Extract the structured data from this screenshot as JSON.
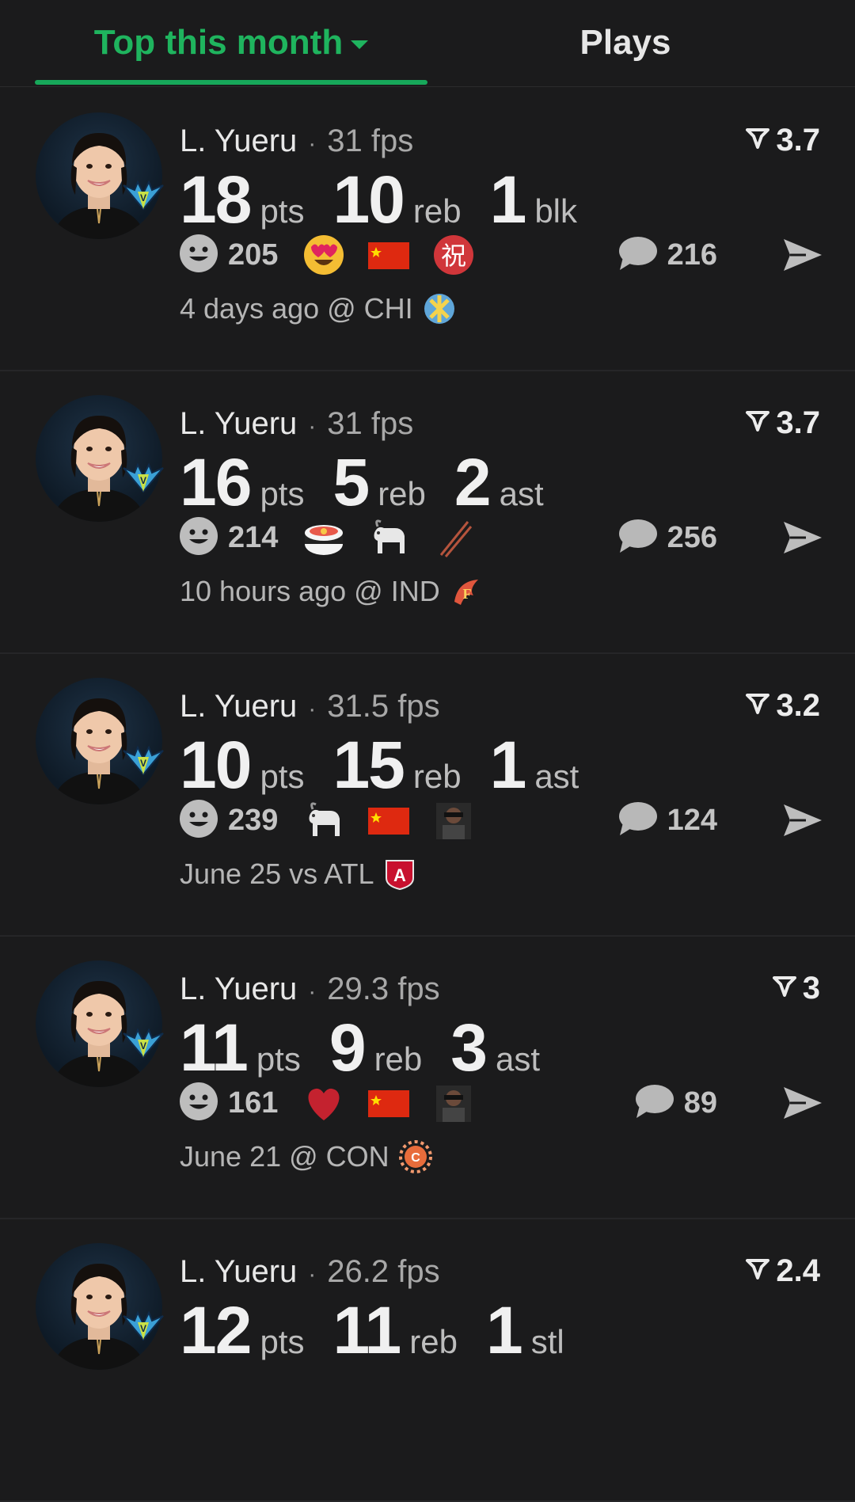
{
  "tabs": {
    "active_label": "Top this month",
    "other_label": "Plays"
  },
  "colors": {
    "accent": "#1fb45e",
    "background": "#1b1b1c"
  },
  "plays": [
    {
      "name": "L. Yueru",
      "separator": "·",
      "fps": "31 fps",
      "rating": "3.7",
      "stats": [
        {
          "value": "18",
          "unit": "pts"
        },
        {
          "value": "10",
          "unit": "reb"
        },
        {
          "value": "1",
          "unit": "blk"
        }
      ],
      "reaction_count": "205",
      "reactions": [
        "heart-eyes-emoji",
        "china-flag",
        "congrats-kanji-emoji"
      ],
      "comment_count": "216",
      "meta": "4 days ago @ CHI",
      "team_logo": "chicago-sky-logo"
    },
    {
      "name": "L. Yueru",
      "separator": "·",
      "fps": "31 fps",
      "rating": "3.7",
      "stats": [
        {
          "value": "16",
          "unit": "pts"
        },
        {
          "value": "5",
          "unit": "reb"
        },
        {
          "value": "2",
          "unit": "ast"
        }
      ],
      "reaction_count": "214",
      "reactions": [
        "sushi-emoji",
        "goat-emoji",
        "chopsticks-emoji"
      ],
      "comment_count": "256",
      "meta": "10 hours ago @ IND",
      "team_logo": "indiana-fever-logo"
    },
    {
      "name": "L. Yueru",
      "separator": "·",
      "fps": "31.5 fps",
      "rating": "3.2",
      "stats": [
        {
          "value": "10",
          "unit": "pts"
        },
        {
          "value": "15",
          "unit": "reb"
        },
        {
          "value": "1",
          "unit": "ast"
        }
      ],
      "reaction_count": "239",
      "reactions": [
        "goat-emoji",
        "china-flag",
        "person-sticker"
      ],
      "comment_count": "124",
      "meta": "June 25 vs ATL",
      "team_logo": "atlanta-dream-logo"
    },
    {
      "name": "L. Yueru",
      "separator": "·",
      "fps": "29.3 fps",
      "rating": "3",
      "stats": [
        {
          "value": "11",
          "unit": "pts"
        },
        {
          "value": "9",
          "unit": "reb"
        },
        {
          "value": "3",
          "unit": "ast"
        }
      ],
      "reaction_count": "161",
      "reactions": [
        "red-heart-emoji",
        "china-flag",
        "person-sticker"
      ],
      "comment_count": "89",
      "meta": "June 21 @ CON",
      "team_logo": "connecticut-sun-logo"
    },
    {
      "name": "L. Yueru",
      "separator": "·",
      "fps": "26.2 fps",
      "rating": "2.4",
      "stats": [
        {
          "value": "12",
          "unit": "pts"
        },
        {
          "value": "11",
          "unit": "reb"
        },
        {
          "value": "1",
          "unit": "stl"
        }
      ]
    }
  ]
}
